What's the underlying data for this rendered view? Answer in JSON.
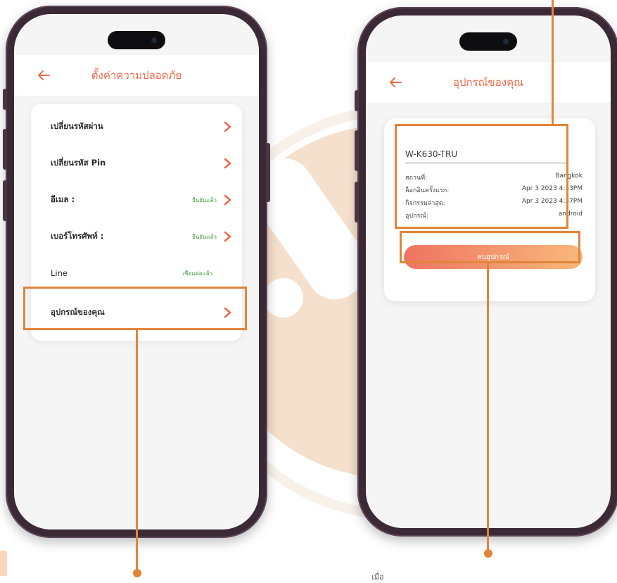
{
  "colors": {
    "accent": "#ee6a4d",
    "callout": "#e0853a",
    "status_green": "#3f9b3f"
  },
  "left_phone": {
    "title": "ตั้งค่าความปลอดภัย",
    "items": [
      {
        "label": "เปลี่ยนรหัสผ่าน",
        "status": "",
        "has_arrow": true
      },
      {
        "label": "เปลี่ยนรหัส Pin",
        "status": "",
        "has_arrow": true
      },
      {
        "label": "อีเมล :",
        "status": "ยืนยันแล้ว",
        "has_arrow": true
      },
      {
        "label": "เบอร์โทรศัพท์ :",
        "status": "ยืนยันแล้ว",
        "has_arrow": true
      },
      {
        "label": "Line",
        "status": "เชื่อมต่อแล้ว",
        "has_arrow": false
      },
      {
        "label": "อุปกรณ์ของคุณ",
        "status": "",
        "has_arrow": true
      }
    ]
  },
  "right_phone": {
    "title": "อุปกรณ์ของคุณ",
    "device": {
      "name": "W-K630-TRU",
      "rows": [
        {
          "key": "สถานที่:",
          "value": "Bangkok"
        },
        {
          "key": "ล็อกอินครั้งแรก:",
          "value": "Apr  3 2023  4:33PM"
        },
        {
          "key": "กิจกรรมล่าสุด:",
          "value": "Apr  3 2023  4:37PM"
        },
        {
          "key": "อุปกรณ์:",
          "value": "android"
        }
      ]
    },
    "delete_button": "ลบอุปกรณ์"
  },
  "captions": {
    "bottom_right": "เมื่อ"
  }
}
